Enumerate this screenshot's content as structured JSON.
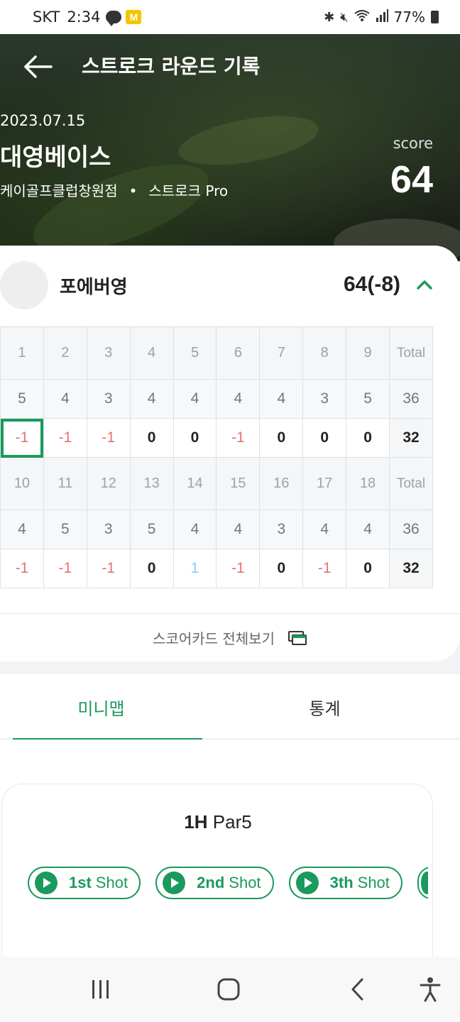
{
  "status_bar": {
    "carrier": "SKT",
    "time": "2:34",
    "talk_badge": "TALK",
    "m_badge": "M",
    "battery": "77%"
  },
  "header": {
    "title": "스트로크 라운드 기록"
  },
  "round": {
    "date": "2023.07.15",
    "course": "대영베이스",
    "store": "케이골프클럽창원점",
    "separator": "•",
    "mode": "스트로크 Pro",
    "score_label": "score",
    "score": "64"
  },
  "player": {
    "name": "포에버영",
    "total": "64(-8)"
  },
  "scorecard": {
    "front": {
      "holes": [
        "1",
        "2",
        "3",
        "4",
        "5",
        "6",
        "7",
        "8",
        "9",
        "Total"
      ],
      "par": [
        "5",
        "4",
        "3",
        "4",
        "4",
        "4",
        "4",
        "3",
        "5",
        "36"
      ],
      "scores": [
        "-1",
        "-1",
        "-1",
        "0",
        "0",
        "-1",
        "0",
        "0",
        "0",
        "32"
      ]
    },
    "back": {
      "holes": [
        "10",
        "11",
        "12",
        "13",
        "14",
        "15",
        "16",
        "17",
        "18",
        "Total"
      ],
      "par": [
        "4",
        "5",
        "3",
        "5",
        "4",
        "4",
        "3",
        "4",
        "4",
        "36"
      ],
      "scores": [
        "-1",
        "-1",
        "-1",
        "0",
        "1",
        "-1",
        "0",
        "-1",
        "0",
        "32"
      ]
    }
  },
  "full_view_label": "스코어카드 전체보기",
  "tabs": [
    {
      "label": "미니맵",
      "active": true
    },
    {
      "label": "통계",
      "active": false
    }
  ],
  "minimap": {
    "hole": "1H",
    "par": "Par5",
    "shots": [
      {
        "num": "1st",
        "label": "Shot"
      },
      {
        "num": "2nd",
        "label": "Shot"
      },
      {
        "num": "3th",
        "label": "Shot"
      }
    ]
  },
  "colors": {
    "accent": "#1a9a5c",
    "negative": "#e57373",
    "positive": "#90caf9"
  }
}
